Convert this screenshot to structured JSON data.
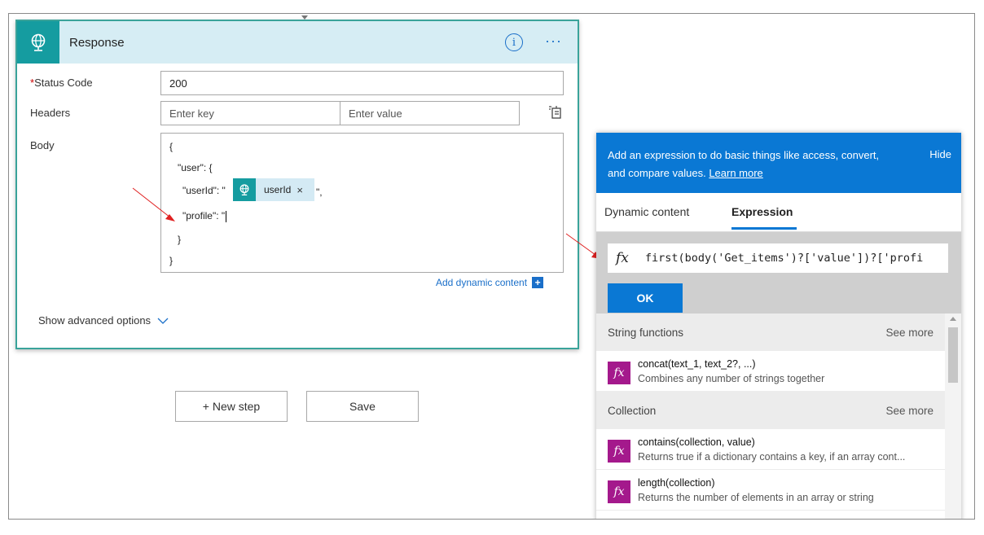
{
  "card": {
    "title": "Response",
    "more_label": "···",
    "info_label": "i"
  },
  "form": {
    "status_code_required_mark": "*",
    "status_code_label": "Status Code",
    "status_code_value": "200",
    "headers_label": "Headers",
    "header_key_placeholder": "Enter key",
    "header_value_placeholder": "Enter value",
    "body_label": "Body",
    "body_lines": {
      "open_brace": "{",
      "user_line": "\"user\": {",
      "userid_prefix": "\"userId\": \"",
      "userid_suffix": "\",",
      "profile_line": "\"profile\": \"",
      "inner_close": "}",
      "outer_close": "}"
    },
    "token_label": "userId",
    "token_close": "×",
    "add_dynamic_label": "Add dynamic content",
    "add_dynamic_plus": "+",
    "show_advanced_label": "Show advanced options"
  },
  "actions": {
    "new_step_label": "+ New step",
    "save_label": "Save"
  },
  "panel": {
    "header_text": "Add an expression to do basic things like access, convert, and compare values.",
    "learn_more_label": "Learn more",
    "hide_label": "Hide",
    "tabs": [
      {
        "label": "Dynamic content"
      },
      {
        "label": "Expression"
      }
    ],
    "fx_label": "fx",
    "expression_value": "first(body('Get_items')?['value'])?['profi",
    "ok_label": "OK",
    "sections": [
      {
        "title": "String functions",
        "see_more": "See more",
        "items": [
          {
            "name": "concat(text_1, text_2?, ...)",
            "desc": "Combines any number of strings together"
          }
        ]
      },
      {
        "title": "Collection",
        "see_more": "See more",
        "items": [
          {
            "name": "contains(collection, value)",
            "desc": "Returns true if a dictionary contains a key, if an array cont..."
          },
          {
            "name": "length(collection)",
            "desc": "Returns the number of elements in an array or string"
          }
        ]
      }
    ]
  },
  "colors": {
    "accent_blue": "#0a78d4",
    "teal": "#159ca0",
    "function_badge": "#a4198c",
    "arrow_red": "#e02020"
  }
}
